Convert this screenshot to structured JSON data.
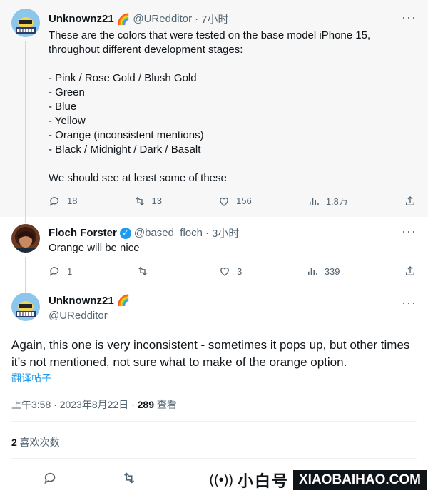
{
  "tweet1": {
    "name": "Unknownz21",
    "emoji": "🌈",
    "handle": "@URedditor",
    "time": "7小时",
    "text": "These are the colors that were tested on the base model iPhone 15,\nthroughout different development stages:\n\n- Pink / Rose Gold / Blush Gold\n- Green\n- Blue\n- Yellow\n- Orange (inconsistent mentions)\n- Black / Midnight / Dark / Basalt\n\nWe should see at least some of these",
    "replies": "18",
    "retweets": "13",
    "likes": "156",
    "views": "1.8万"
  },
  "tweet2": {
    "name": "Floch Forster",
    "handle": "@based_floch",
    "time": "3小时",
    "text": "Orange will be nice",
    "replies": "1",
    "retweets": "",
    "likes": "3",
    "views": "339"
  },
  "tweet3": {
    "name": "Unknownz21",
    "emoji": "🌈",
    "handle": "@URedditor",
    "text": "Again, this one is very inconsistent - sometimes it pops up, but other times it’s not mentioned, not sure what to make of the orange option.",
    "translate": "翻译帖子",
    "timestamp": "上午3:58 · 2023年8月22日 · ",
    "view_count": "289",
    "view_label": " 查看",
    "like_count": "2",
    "like_label": " 喜欢次数"
  },
  "separator": "·",
  "more": "···",
  "watermark": {
    "cn": "小白号",
    "en": "XIAOBAIHAO.COM"
  },
  "colors": {
    "accent": "#1d9bf0",
    "text": "#0f1419",
    "muted": "#536471"
  }
}
